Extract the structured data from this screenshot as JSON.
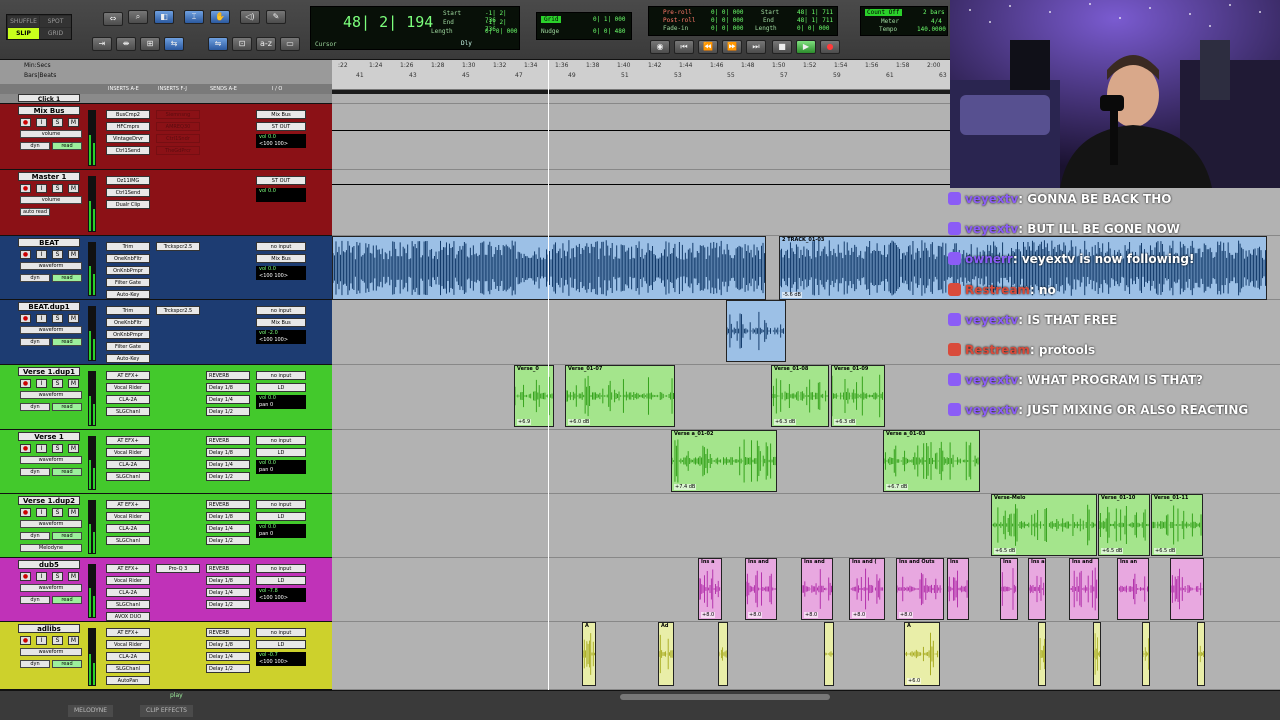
{
  "toolbar": {
    "modes": [
      "SHUFFLE",
      "SPOT",
      "SLIP",
      "GRID"
    ],
    "counter": {
      "main": "48| 2| 194",
      "label": "Cursor",
      "start_label": "Start",
      "end_label": "End",
      "length_label": "Length",
      "start": "-1| 2| 736",
      "end": "-1| 2| 736",
      "length": "0| 0| 000",
      "dly": "Dly"
    },
    "grid": {
      "label": "Grid",
      "value": "0| 1| 000",
      "nudge_label": "Nudge",
      "nudge": "0| 0| 480"
    },
    "transport": {
      "preroll_label": "Pre-roll",
      "postroll_label": "Post-roll",
      "fadein_label": "Fade-in",
      "preroll": "0| 0| 000",
      "postroll": "0| 0| 000",
      "fadein": "0| 0| 000",
      "start": "48| 1| 711",
      "end": "48| 1| 711",
      "length": "0| 0| 000",
      "start_label": "Start",
      "end_label": "End",
      "length_label": "Length"
    },
    "meter": {
      "countoff": "Count Off",
      "meter_label": "Meter",
      "tempo_label": "Tempo",
      "meter": "4/4",
      "tempo": "140.0000",
      "bars": "2 bars"
    }
  },
  "ruler": {
    "min_secs": "Min:Secs",
    "bars_beats": "Bars|Beats",
    "times": [
      ":22",
      "1:24",
      "1:26",
      "1:28",
      "1:30",
      "1:32",
      "1:34",
      "1:36",
      "1:38",
      "1:40",
      "1:42",
      "1:44",
      "1:46",
      "1:48",
      "1:50",
      "1:52",
      "1:54",
      "1:56",
      "1:58",
      "2:00"
    ],
    "bars": [
      "41",
      "43",
      "45",
      "47",
      "49",
      "51",
      "53",
      "55",
      "57",
      "59",
      "61",
      "63"
    ]
  },
  "columns": [
    "INSERTS A-E",
    "INSERTS F-J",
    "SENDS A-E",
    "I / O"
  ],
  "tracks": [
    {
      "name": "Click 1",
      "color": "#8a8a8a"
    },
    {
      "name": "Mix Bus",
      "color": "#8b1116",
      "view": "volume",
      "mode": "dyn",
      "auto": "read",
      "inserts": [
        "BusCmp2",
        "HFCmprs",
        "VintageDrvr",
        "Ctrl1Send"
      ],
      "dim_inserts": [
        "Siemnsng",
        "AMREQ30",
        "Ctrl1Sndr",
        "TheGdPrcr"
      ],
      "io_in": "Mix Bus",
      "io_out": "ST OUT",
      "vol": "vol 0.0",
      "pan": "<100 100>"
    },
    {
      "name": "Master 1",
      "color": "#8b1116",
      "view": "volume",
      "mode": "auto read",
      "inserts": [
        "Oz11IMG",
        "Ctrl1Send",
        "Dualr Clip"
      ],
      "io_out": "ST OUT",
      "vol": "vol 0.0"
    },
    {
      "name": "BEAT",
      "color": "#1d3c72",
      "view": "waveform",
      "mode": "dyn",
      "auto": "read",
      "inserts": [
        "Trim",
        "OneKnbFltr",
        "OnKnbPmpr",
        "Filter Gate",
        "Auto-Key"
      ],
      "ins2": "Trckspcr2.5",
      "io_in": "no input",
      "io_out": "Mix Bus",
      "vol": "vol 0.0",
      "pan": "<100 100>"
    },
    {
      "name": "BEAT.dup1",
      "color": "#1d3c72",
      "view": "waveform",
      "mode": "dyn",
      "auto": "read",
      "inserts": [
        "Trim",
        "OneKnbFltr",
        "OnKnbPmpr",
        "Filter Gate",
        "Auto-Key"
      ],
      "ins2": "Trckspcr2.5",
      "io_in": "no input",
      "io_out": "Mix Bus",
      "vol": "vol -2.0",
      "pan": "<100 100>"
    },
    {
      "name": "Verse 1.dup1",
      "color": "#43c92c",
      "view": "waveform",
      "mode": "dyn",
      "auto": "read",
      "inserts": [
        "AT EFX+",
        "Vocal Rider",
        "CLA-2A",
        "SLGChanl"
      ],
      "sends": [
        "REVERB",
        "Delay 1/8",
        "Delay 1/4",
        "Delay 1/2"
      ],
      "io_in": "no input",
      "io_out": "LD",
      "vol": "vol 0.0",
      "pan": "pan 0"
    },
    {
      "name": "Verse 1",
      "color": "#43c92c",
      "view": "waveform",
      "mode": "dyn",
      "auto": "read",
      "inserts": [
        "AT EFX+",
        "Vocal Rider",
        "CLA-2A",
        "SLGChanl"
      ],
      "sends": [
        "REVERB",
        "Delay 1/8",
        "Delay 1/4",
        "Delay 1/2"
      ],
      "io_in": "no input",
      "io_out": "LD",
      "vol": "vol 0.0",
      "pan": "pan 0"
    },
    {
      "name": "Verse 1.dup2",
      "color": "#43c92c",
      "view": "waveform",
      "mode": "dyn",
      "auto": "read",
      "inserts": [
        "AT EFX+",
        "Vocal Rider",
        "CLA-2A",
        "SLGChanl"
      ],
      "sends": [
        "REVERB",
        "Delay 1/8",
        "Delay 1/4",
        "Delay 1/2"
      ],
      "io_in": "no input",
      "io_out": "LD",
      "vol": "vol 0.0",
      "pan": "pan 0",
      "extra": "Melodyne"
    },
    {
      "name": "dub5",
      "color": "#c032b8",
      "view": "waveform",
      "mode": "dyn",
      "auto": "read",
      "inserts": [
        "AT EFX+",
        "Vocal Rider",
        "CLA-2A",
        "SLGChanl",
        "AVOX DUO"
      ],
      "ins2": "Pro-Q 3",
      "sends": [
        "REVERB",
        "Delay 1/8",
        "Delay 1/4",
        "Delay 1/2"
      ],
      "io_in": "no input",
      "io_out": "LD",
      "vol": "vol -7.8",
      "pan": "<100 100>"
    },
    {
      "name": "adlibs",
      "color": "#cdd12c",
      "view": "waveform",
      "mode": "dyn",
      "auto": "read",
      "inserts": [
        "AT EFX+",
        "Vocal Rider",
        "CLA-2A",
        "SLGChanl",
        "AutoPan"
      ],
      "sends": [
        "REVERB",
        "Delay 1/8",
        "Delay 1/4",
        "Delay 1/2"
      ],
      "io_in": "no input",
      "io_out": "LD",
      "vol": "vol -0.7",
      "pan": "<100 100>"
    }
  ],
  "clips": {
    "beat": [
      {
        "name": "",
        "gain": ""
      },
      {
        "name": "2 TRACK_01-03",
        "gain": "-5.6 dB"
      }
    ],
    "verse1dup1": [
      {
        "name": "Verse_0",
        "gain": "+6.9"
      },
      {
        "name": "Verse_01-07",
        "gain": "+6.0 dB"
      },
      {
        "name": "Verse_01-08",
        "gain": "+6.3 dB"
      },
      {
        "name": "Verse_01-09",
        "gain": "+6.3 dB"
      }
    ],
    "verse1": [
      {
        "name": "Verse a_01-02",
        "gain": "+7.4 dB"
      },
      {
        "name": "Verse a_01-03",
        "gain": "+6.7 dB"
      }
    ],
    "verse1dup2": [
      {
        "name": "Verse-Melo",
        "gain": "+6.5 dB"
      },
      {
        "name": "Verse_01-10",
        "gain": "+6.5 dB"
      },
      {
        "name": "Verse_01-11",
        "gain": "+6.5 dB"
      }
    ],
    "dub5": [
      "Ins a",
      "Ins and",
      "Ins and",
      "Ins and (",
      "Ins and Outs",
      "Ins",
      "Ins",
      "Ins and",
      "Ins and",
      "Ins an"
    ],
    "dub5_gains": [
      "+8.0",
      "+8.0",
      "+8.0",
      "+8.0",
      "+8.0"
    ],
    "adlibs": [
      "A",
      "Ad",
      "",
      "",
      "A",
      "",
      "",
      "",
      ""
    ],
    "adlib_gain": "+6.0"
  },
  "bottom": {
    "tabs": [
      "MELODYNE",
      "CLIP EFFECTS"
    ],
    "play": "play"
  },
  "chat": [
    {
      "user": "veyextv",
      "platform": "twitch",
      "text": "GONNA BE BACK THO"
    },
    {
      "user": "veyextv",
      "platform": "twitch",
      "text": "BUT ILL BE GONE NOW"
    },
    {
      "user": "ownerr",
      "platform": "twitch",
      "text": "veyextv is now following!"
    },
    {
      "user": "Restream",
      "platform": "restream",
      "text": "no"
    },
    {
      "user": "veyextv",
      "platform": "twitch",
      "text": "IS THAT FREE"
    },
    {
      "user": "Restream",
      "platform": "restream",
      "text": "protools"
    },
    {
      "user": "veyextv",
      "platform": "twitch",
      "text": "WHAT PROGRAM IS THAT?"
    },
    {
      "user": "veyextv",
      "platform": "twitch",
      "text": "JUST MIXING OR ALSO REACTING"
    }
  ]
}
